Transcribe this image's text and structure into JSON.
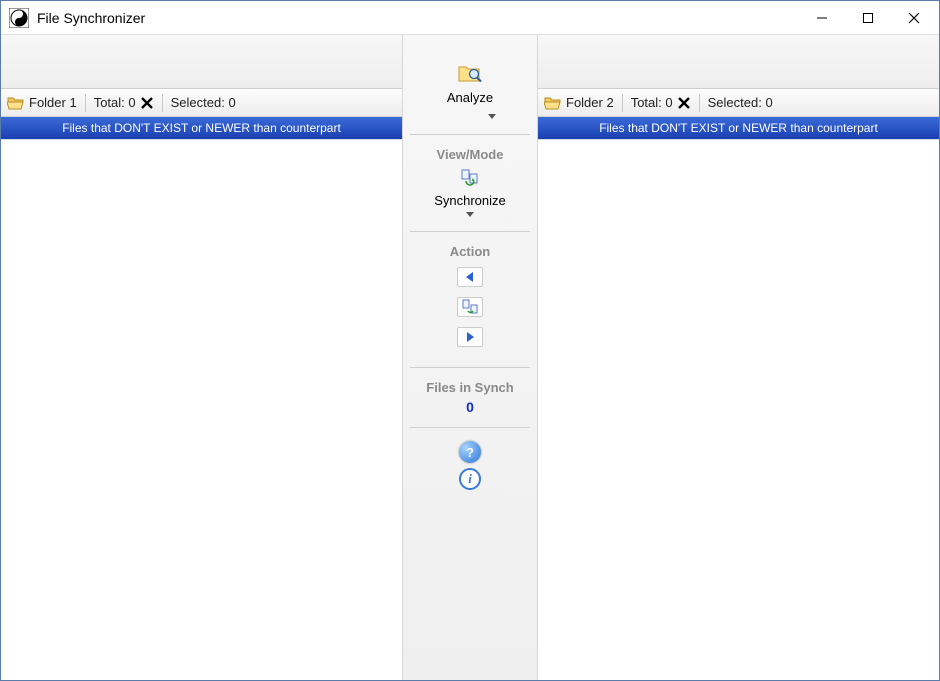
{
  "window": {
    "title": "File Synchronizer"
  },
  "left": {
    "folder_label": "Folder 1",
    "total_label": "Total: 0",
    "selected_label": "Selected: 0",
    "header": "Files that DON'T EXIST or NEWER than counterpart"
  },
  "right": {
    "folder_label": "Folder 2",
    "total_label": "Total: 0",
    "selected_label": "Selected: 0",
    "header": "Files that DON'T EXIST or NEWER than counterpart"
  },
  "center": {
    "analyze_label": "Analyze",
    "view_mode_label": "View/Mode",
    "mode_value": "Synchronize",
    "action_label": "Action",
    "files_in_synch_label": "Files in Synch",
    "files_in_synch_count": "0",
    "help_glyph": "?",
    "info_glyph": "i"
  }
}
